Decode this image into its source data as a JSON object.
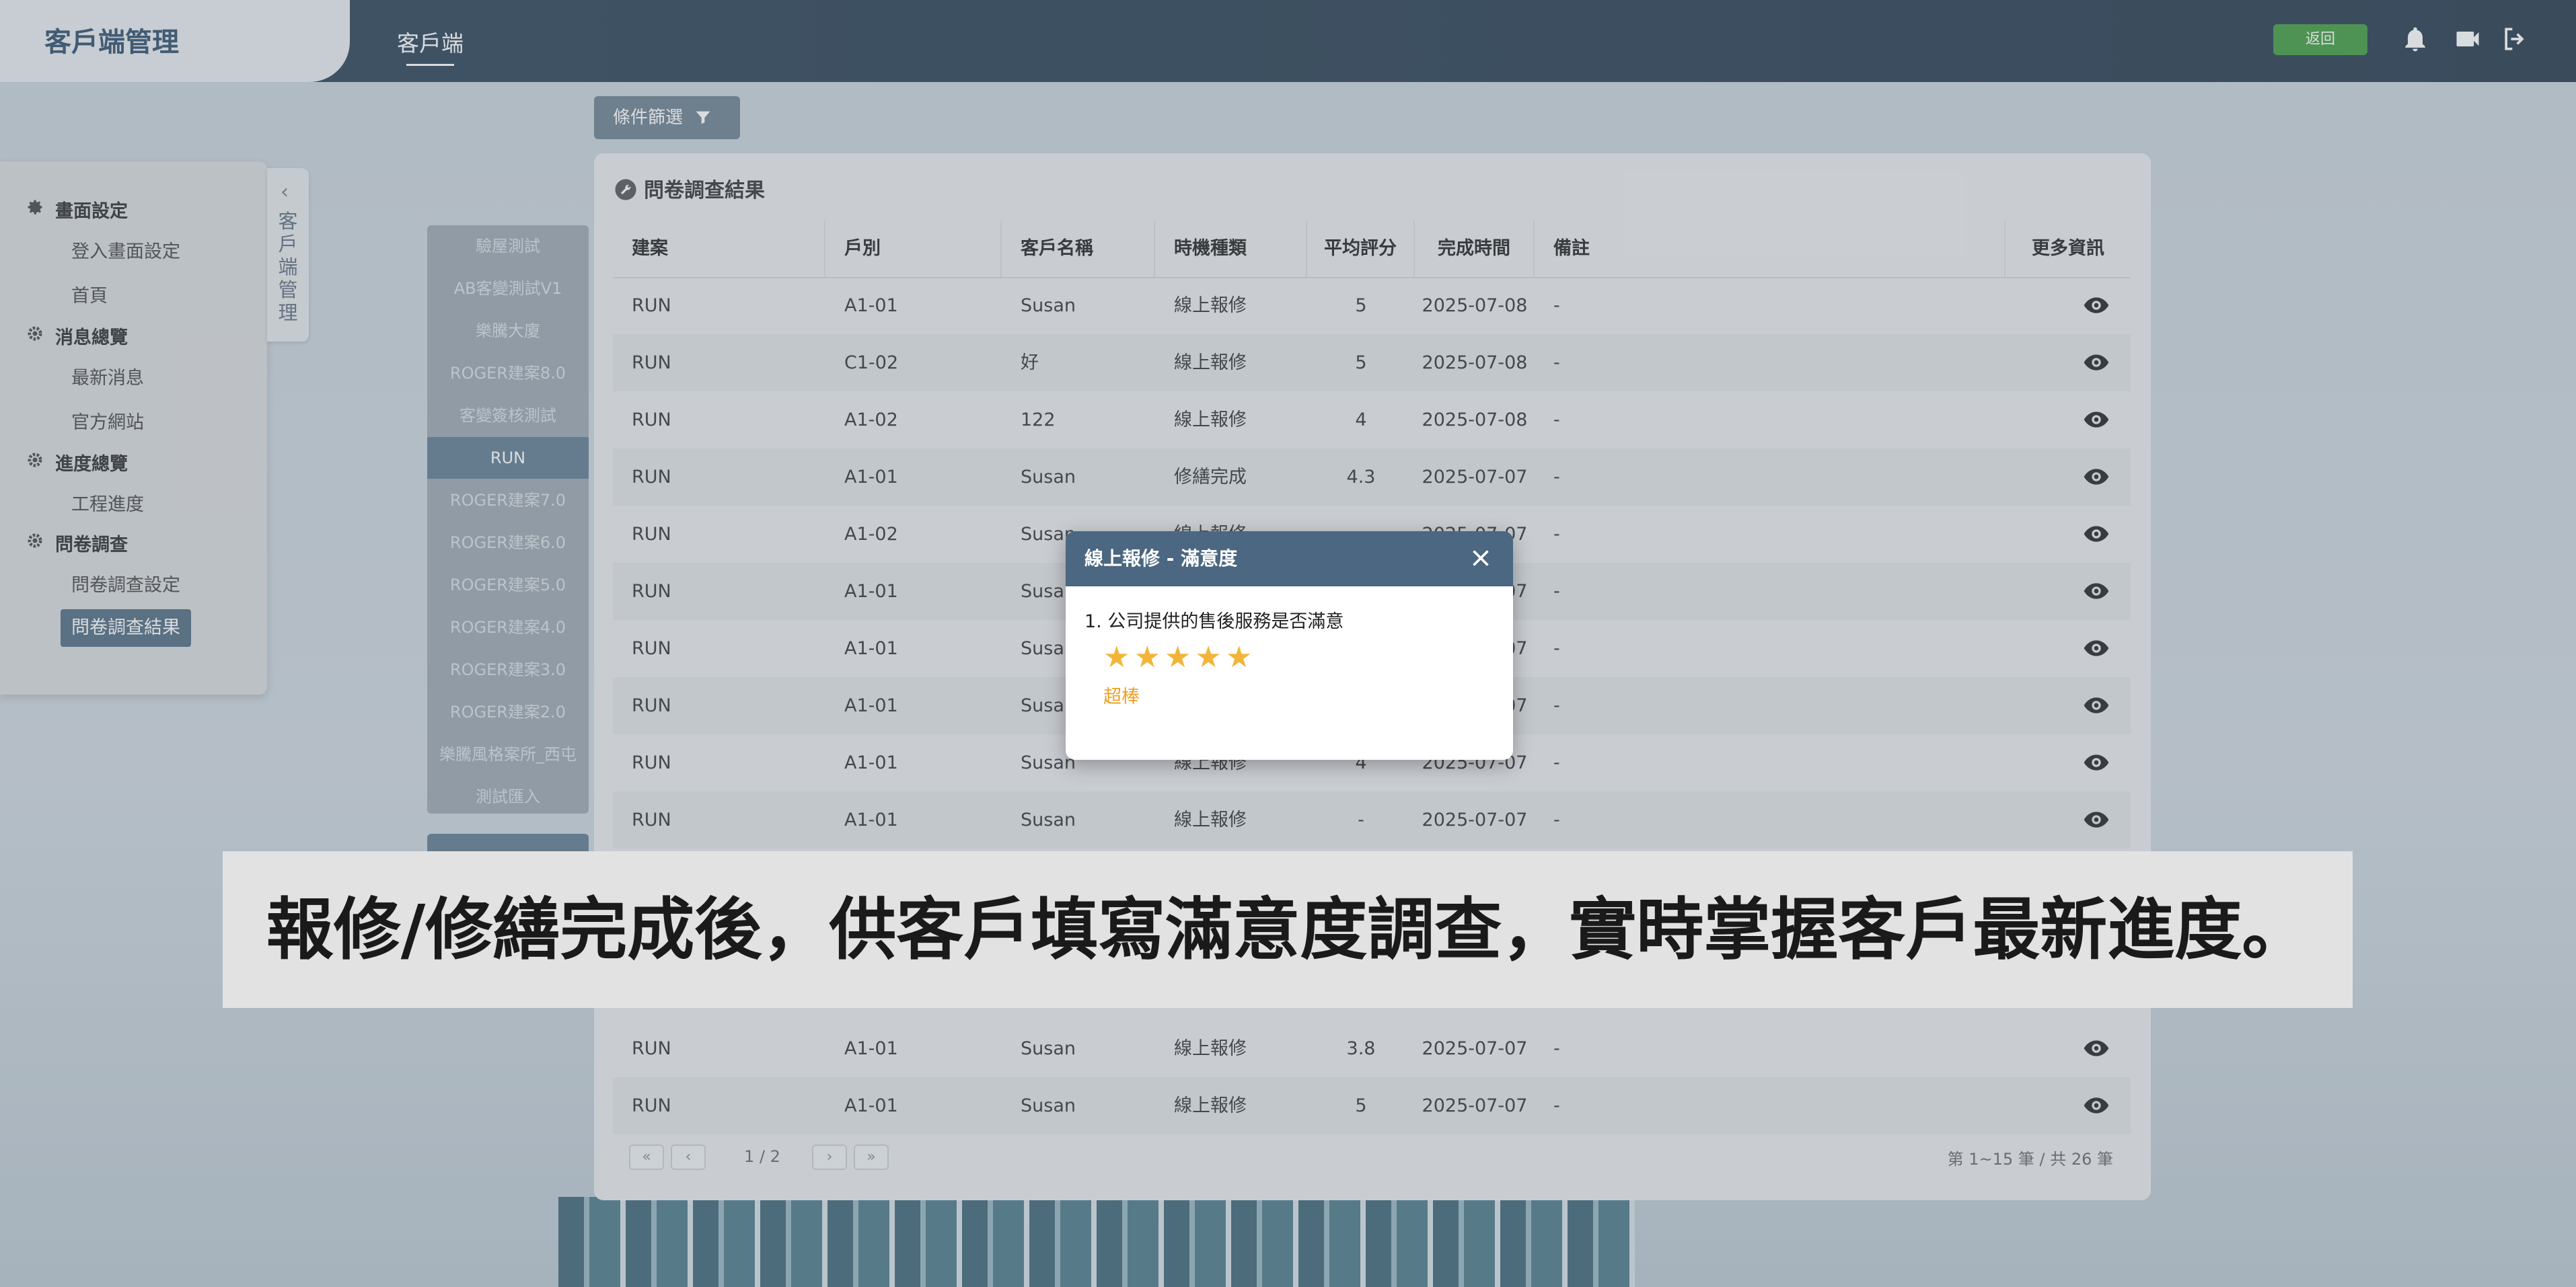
{
  "app": {
    "title": "客戶端管理",
    "tab": "客戶端",
    "back_label": "返回"
  },
  "filter": {
    "label": "條件篩選"
  },
  "sidemenu": {
    "vertical_tab": "客戶端管理",
    "groups": [
      {
        "label": "畫面設定",
        "items": [
          "登入畫面設定",
          "首頁"
        ]
      },
      {
        "label": "消息總覽",
        "items": [
          "最新消息",
          "官方網站"
        ]
      },
      {
        "label": "進度總覽",
        "items": [
          "工程進度"
        ]
      },
      {
        "label": "問卷調查",
        "items": [
          "問卷調查設定",
          "問卷調查結果"
        ]
      }
    ]
  },
  "projects": [
    "驗屋測試",
    "AB客變測試V1",
    "樂騰大廈",
    "ROGER建案8.0",
    "客變簽核測試",
    "RUN",
    "ROGER建案7.0",
    "ROGER建案6.0",
    "ROGER建案5.0",
    "ROGER建案4.0",
    "ROGER建案3.0",
    "ROGER建案2.0",
    "樂騰風格案所_西屯",
    "測試匯入"
  ],
  "panel": {
    "title": "問卷調查結果",
    "columns": [
      "建案",
      "戶別",
      "客戶名稱",
      "時機種類",
      "平均評分",
      "完成時間",
      "備註",
      "更多資訊"
    ],
    "rows": [
      [
        "RUN",
        "A1-01",
        "Susan",
        "線上報修",
        "5",
        "2025-07-08",
        "-"
      ],
      [
        "RUN",
        "C1-02",
        "好",
        "線上報修",
        "5",
        "2025-07-08",
        "-"
      ],
      [
        "RUN",
        "A1-02",
        "122",
        "線上報修",
        "4",
        "2025-07-08",
        "-"
      ],
      [
        "RUN",
        "A1-01",
        "Susan",
        "修繕完成",
        "4.3",
        "2025-07-07",
        "-"
      ],
      [
        "RUN",
        "A1-02",
        "Susan",
        "線上報修",
        "",
        "2025-07-07",
        "-"
      ],
      [
        "RUN",
        "A1-01",
        "Susan",
        "",
        "",
        "2025-07-07",
        "-"
      ],
      [
        "RUN",
        "A1-01",
        "Susan",
        "",
        "",
        "2025-07-07",
        "-"
      ],
      [
        "RUN",
        "A1-01",
        "Susan",
        "",
        "",
        "2025-07-07",
        "-"
      ],
      [
        "RUN",
        "A1-01",
        "Susan",
        "線上報修",
        "4",
        "2025-07-07",
        "-"
      ],
      [
        "RUN",
        "A1-01",
        "Susan",
        "線上報修",
        "-",
        "2025-07-07",
        "-"
      ],
      [
        "RUN",
        "A1-01",
        "Susan",
        "線上報修",
        "3.8",
        "2025-07-07",
        "-"
      ],
      [
        "RUN",
        "A1-01",
        "Susan",
        "線上報修",
        "5",
        "2025-07-07",
        "-"
      ]
    ],
    "pager": {
      "first": "«",
      "prev": "‹",
      "info": "1 / 2",
      "next": "›",
      "last": "»"
    },
    "total": "第 1~15 筆 / 共 26 筆"
  },
  "modal": {
    "title": "線上報修 - 滿意度",
    "question": "1. 公司提供的售後服務是否滿意",
    "rating": 5,
    "rating_max": 5,
    "rating_word": "超棒"
  },
  "caption": "報修/修繕完成後，供客戶填寫滿意度調查，實時掌握客戶最新進度。",
  "colors": {
    "topbar": "#2b4257",
    "accent": "#4b6781",
    "back_button": "#3f9a3e",
    "star": "#f2b53a"
  }
}
